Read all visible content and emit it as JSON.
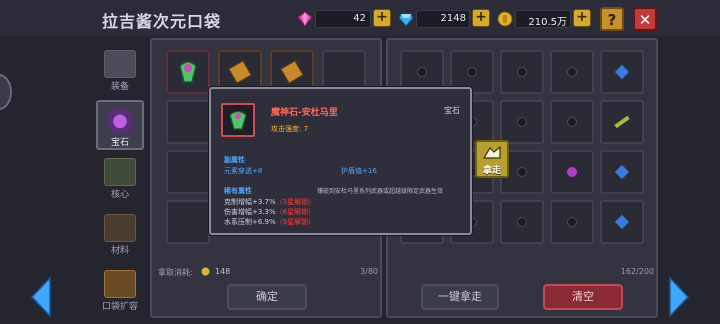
{
  "header": {
    "title": "拉吉酱次元口袋",
    "gems": "42",
    "diamonds": "2148",
    "coins": "210.5万",
    "help_label": "?",
    "close_label": "✕"
  },
  "nav": [
    {
      "label": "装备",
      "icon": "equipment-icon"
    },
    {
      "label": "宝石",
      "icon": "gem-icon"
    },
    {
      "label": "核心",
      "icon": "core-icon"
    },
    {
      "label": "材料",
      "icon": "material-icon"
    },
    {
      "label": "口袋扩容",
      "icon": "chest-icon"
    }
  ],
  "left_panel": {
    "cost_label": "拿取消耗:",
    "cost_value": "148",
    "capacity": "3/80",
    "confirm_label": "确定"
  },
  "right_panel": {
    "capacity": "162/200",
    "take_all_label": "一键拿走",
    "clear_label": "清空"
  },
  "tooltip": {
    "name": "魔神石-安杜马里",
    "type": "宝石",
    "attack_label": "攻击强度: 7",
    "sub_attr_title": "副属性",
    "sub_attr_1": "元素穿透+8",
    "sub_attr_2": "护盾值+16",
    "unique_title": "稀有属性",
    "unique_note": "镶嵌到安杜马里系列武器或超越级限定武器生效",
    "unique_lines": [
      {
        "text": "克制增幅+3.7%",
        "req": "（3星解锁）"
      },
      {
        "text": "伤害增幅+3.3%",
        "req": "（6星解锁）"
      },
      {
        "text": "水系压制+6.9%",
        "req": "（9星解锁）"
      }
    ]
  },
  "take_button": {
    "label": "拿走"
  },
  "colors": {
    "accent_red": "#e23a4a",
    "accent_orange": "#ff9a2e",
    "sub_attr_blue": "#4ea6ff",
    "gold": "#d6a92a",
    "arrow_blue": "#3fa7ff"
  }
}
